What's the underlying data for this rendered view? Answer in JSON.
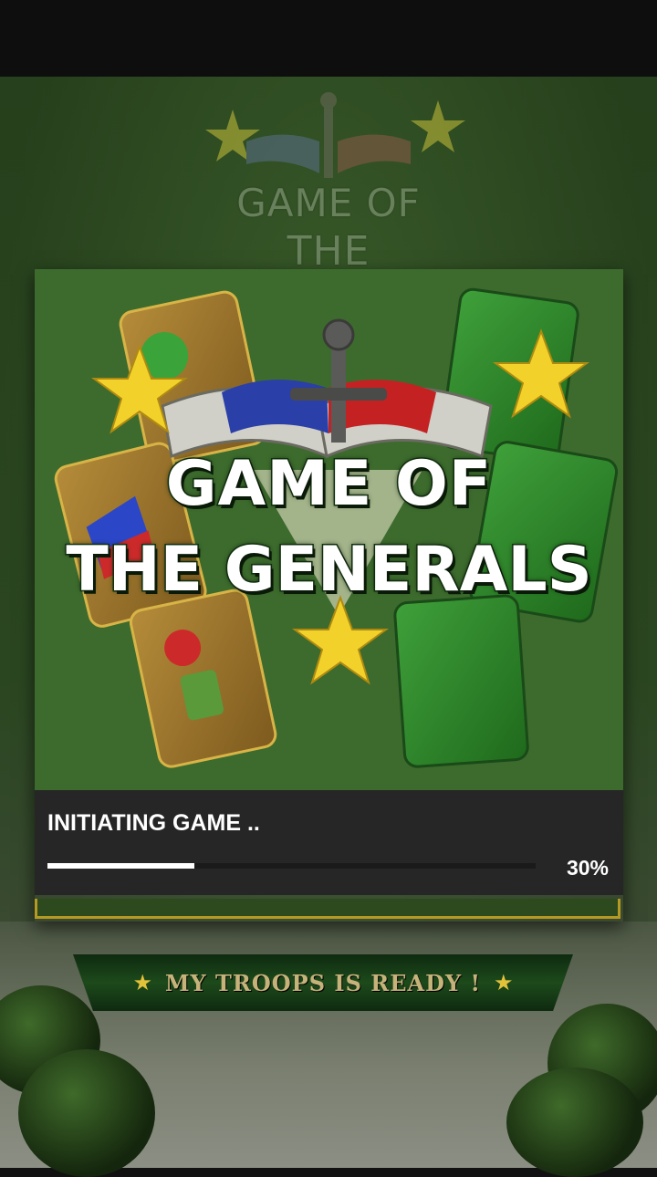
{
  "background": {
    "logo_line1": "GAME OF",
    "logo_line2": "THE GENERALS",
    "banner_text": "MY TROOPS IS READY !"
  },
  "splash": {
    "logo_line1": "GAME OF",
    "logo_line2": "THE GENERALS"
  },
  "loading": {
    "title": "INITIATING GAME ..",
    "progress_percent": 30,
    "progress_label": "30%"
  },
  "colors": {
    "splash_bg": "#3d6b2d",
    "panel_bg": "#262626",
    "star_yellow": "#f2d22a",
    "banner_green": "#1d4a1b"
  }
}
